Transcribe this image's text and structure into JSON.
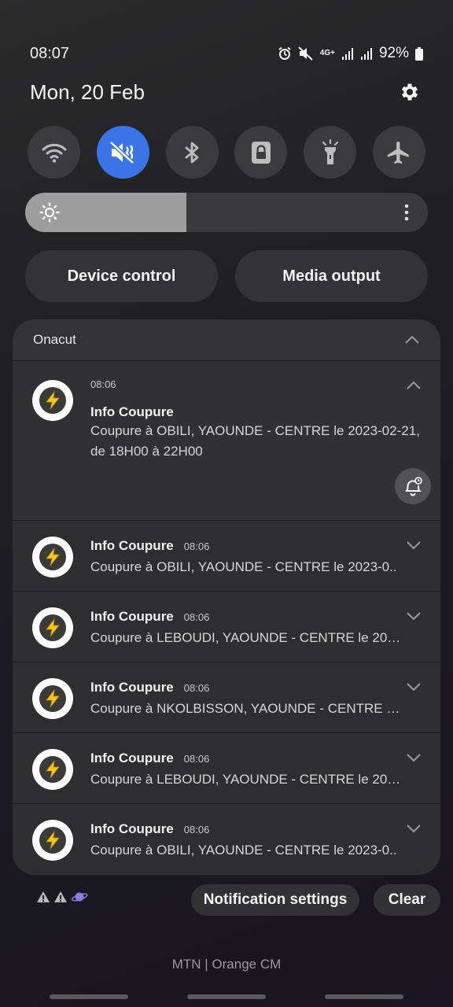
{
  "status_bar": {
    "time": "08:07",
    "network": "4G+",
    "battery": "92%",
    "icons": [
      "alarm-icon",
      "mute-icon",
      "network-4g-icon",
      "signal-icon",
      "signal-icon",
      "battery-icon"
    ]
  },
  "header": {
    "date": "Mon, 20 Feb",
    "settings_icon": "gear-icon"
  },
  "quick_settings": [
    {
      "name": "wifi",
      "icon": "wifi-icon",
      "active": false
    },
    {
      "name": "mute",
      "icon": "mute-icon",
      "active": true
    },
    {
      "name": "bluetooth",
      "icon": "bluetooth-icon",
      "active": false
    },
    {
      "name": "screen-lock",
      "icon": "lock-icon",
      "active": false
    },
    {
      "name": "flashlight",
      "icon": "flashlight-icon",
      "active": false
    },
    {
      "name": "airplane",
      "icon": "airplane-icon",
      "active": false
    }
  ],
  "brightness": {
    "level": 0.4
  },
  "controls": {
    "device_control": "Device control",
    "media_output": "Media output"
  },
  "notifications": {
    "app_name": "Onacut",
    "expanded": {
      "time": "08:06",
      "title": "Info Coupure",
      "body": "Coupure à  OBILI, YAOUNDE - CENTRE le 2023-02-21, de 18H00 à 22H00"
    },
    "items": [
      {
        "title": "Info Coupure",
        "time": "08:06",
        "body": "Coupure à  OBILI, YAOUNDE - CENTRE le 2023-0.."
      },
      {
        "title": "Info Coupure",
        "time": "08:06",
        "body": "Coupure à  LEBOUDI, YAOUNDE - CENTRE le 202.."
      },
      {
        "title": "Info Coupure",
        "time": "08:06",
        "body": "Coupure à NKOLBISSON, YAOUNDE - CENTRE le .."
      },
      {
        "title": "Info Coupure",
        "time": "08:06",
        "body": "Coupure à  LEBOUDI, YAOUNDE - CENTRE le 202.."
      },
      {
        "title": "Info Coupure",
        "time": "08:06",
        "body": "Coupure à  OBILI, YAOUNDE - CENTRE le 2023-0.."
      }
    ]
  },
  "footer": {
    "notification_settings": "Notification settings",
    "clear": "Clear",
    "carrier": "MTN | Orange CM"
  },
  "colors": {
    "accent": "#3a74e6",
    "background": "#1f1f22",
    "panel": "#333335"
  }
}
